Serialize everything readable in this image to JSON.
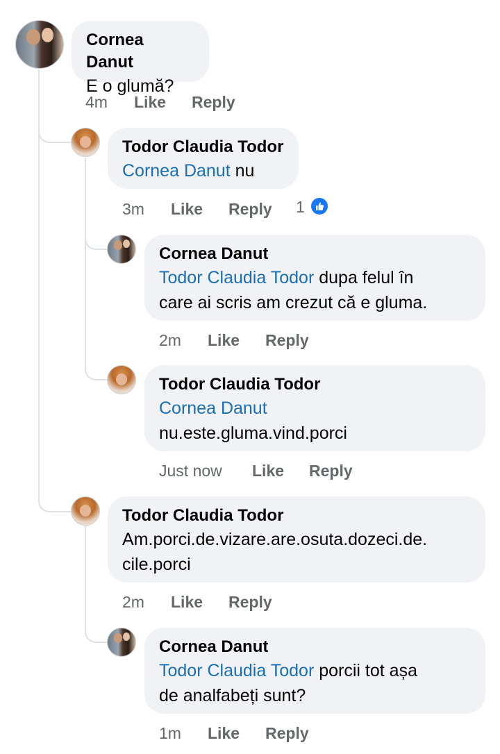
{
  "comments": [
    {
      "author": "Cornea Danut",
      "mention": "",
      "text": "E o glumă?",
      "time": "4m",
      "like_label": "Like",
      "reply_label": "Reply",
      "avatar": "cornea-danut-avatar"
    },
    {
      "author": "Todor Claudia Todor",
      "mention": "Cornea Danut",
      "text": " nu",
      "time": "3m",
      "like_label": "Like",
      "reply_label": "Reply",
      "reaction_count": "1",
      "reaction_icon": "thumbs-up-icon",
      "avatar": "todor-claudia-avatar"
    },
    {
      "author": "Cornea Danut",
      "mention": "Todor Claudia Todor",
      "text_line1": " dupa felul în",
      "text_line2": "care ai scris am crezut că e gluma.",
      "time": "2m",
      "like_label": "Like",
      "reply_label": "Reply",
      "avatar": "cornea-danut-avatar"
    },
    {
      "author": "Todor Claudia Todor",
      "mention": "Cornea Danut",
      "text": "nu.este.gluma.vind.porci",
      "time": "Just now",
      "like_label": "Like",
      "reply_label": "Reply",
      "avatar": "todor-claudia-avatar"
    },
    {
      "author": "Todor Claudia Todor",
      "text_line1": "Am.porci.de.vizare.are.osuta.dozeci.de.",
      "text_line2": "cile.porci",
      "time": "2m",
      "like_label": "Like",
      "reply_label": "Reply",
      "avatar": "todor-claudia-avatar"
    },
    {
      "author": "Cornea Danut",
      "mention": "Todor Claudia Todor",
      "text_line1": " porcii tot așa",
      "text_line2": "de analfabeți sunt?",
      "time": "1m",
      "like_label": "Like",
      "reply_label": "Reply",
      "avatar": "cornea-danut-avatar"
    }
  ],
  "colors": {
    "bubble": "#f0f2f5",
    "mention": "#1a6fb4",
    "meta": "#65676b",
    "like_badge": "#1877f2"
  }
}
